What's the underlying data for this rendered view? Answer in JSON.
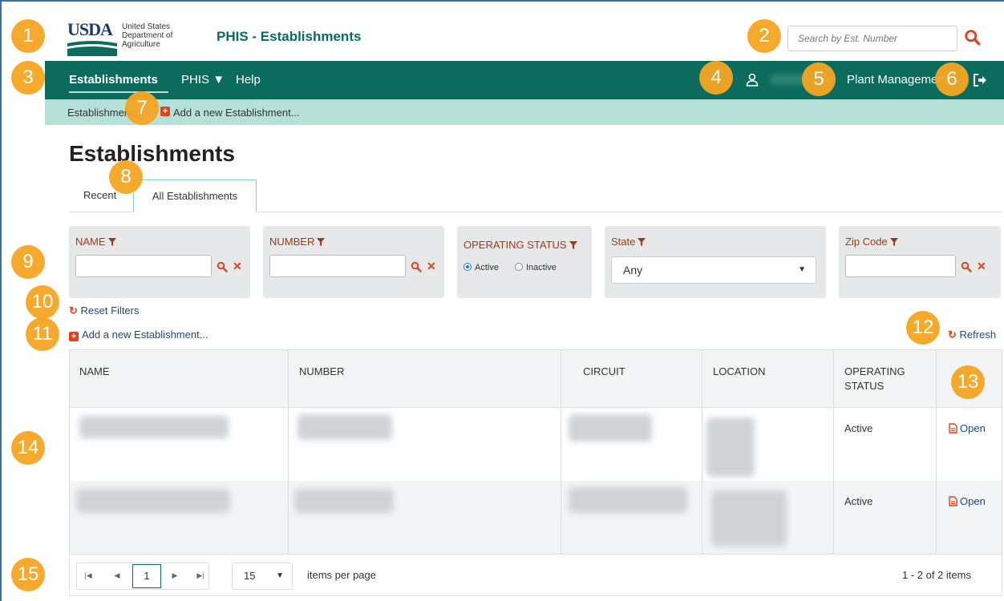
{
  "header": {
    "logo_word": "USDA",
    "logo_sub": "United States Department of Agriculture",
    "app_title": "PHIS - Establishments",
    "search_placeholder": "Search by Est. Number"
  },
  "navbar": {
    "items": [
      "Establishments",
      "PHIS",
      "Help"
    ],
    "plant_label": "Plant Management"
  },
  "breadcrumb": {
    "root": "Establishments",
    "add_label": "Add a new Establishment..."
  },
  "page": {
    "title": "Establishments",
    "tabs": [
      {
        "label": "Recent",
        "active": false
      },
      {
        "label": "All Establishments",
        "active": true
      }
    ]
  },
  "filters": {
    "name_label": "NAME",
    "number_label": "NUMBER",
    "status_label": "OPERATING STATUS",
    "status_options": [
      "Active",
      "Inactive"
    ],
    "status_selected": "Active",
    "state_label": "State",
    "state_value": "Any",
    "zip_label": "Zip Code"
  },
  "actions": {
    "reset": "Reset Filters",
    "add": "Add a new Establishment...",
    "refresh": "Refresh"
  },
  "table": {
    "columns": [
      "NAME",
      "NUMBER",
      "CIRCUIT",
      "LOCATION",
      "OPERATING STATUS"
    ],
    "rows": [
      {
        "status": "Active",
        "action": "Open"
      },
      {
        "status": "Active",
        "action": "Open"
      }
    ]
  },
  "pager": {
    "current_page": "1",
    "page_size": "15",
    "items_label": "items per page",
    "info": "1 - 2 of 2 items"
  },
  "callouts": [
    "1",
    "2",
    "3",
    "4",
    "5",
    "6",
    "7",
    "8",
    "9",
    "10",
    "11",
    "12",
    "13",
    "14",
    "15"
  ],
  "colors": {
    "brand_green": "#0b6b5c",
    "breadcrumb_bg": "#b6e1d9",
    "accent_orange": "#e0421b",
    "callout": "#f5a623"
  }
}
